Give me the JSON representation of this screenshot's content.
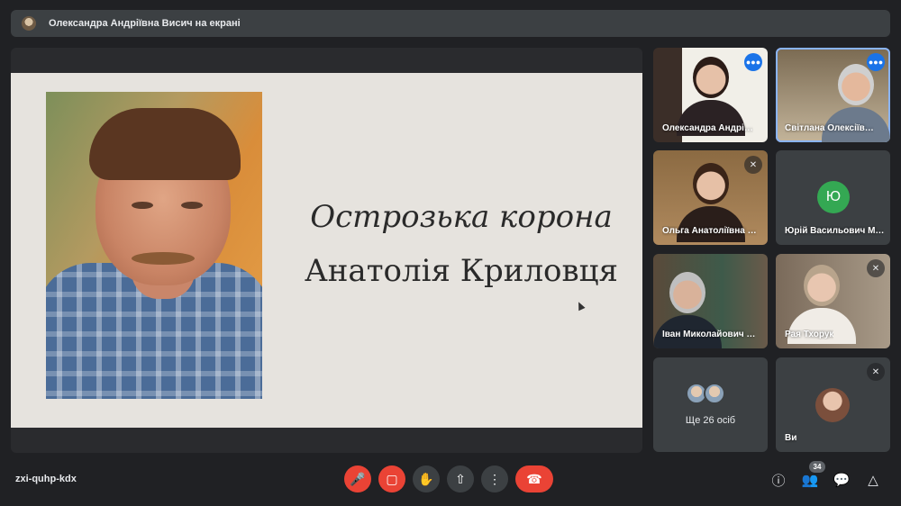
{
  "banner": {
    "presenting_text": "Олександра Андріївна Висич на екрані"
  },
  "slide": {
    "title_line1": "Острозька корона",
    "title_line2": "Анатолія Криловця"
  },
  "tiles": [
    {
      "name": "Олександра Андрі…",
      "status_icon": "speaking-icon"
    },
    {
      "name": "Світлана Олексіїв…",
      "status_icon": "speaking-icon",
      "active": true
    },
    {
      "name": "Ольга Анатоліївна …",
      "status_icon": "mic-off-icon"
    },
    {
      "name": "Юрій Васильович М…",
      "avatar_letter": "Ю",
      "avatar_color": "#34a853"
    },
    {
      "name": "Іван Миколайович …"
    },
    {
      "name": "Рая Тхорук",
      "status_icon": "mic-off-icon"
    },
    {
      "more_label": "Ще 26 осіб"
    },
    {
      "name": "Ви",
      "status_icon": "mic-off-icon"
    }
  ],
  "bottom": {
    "meeting_code": "zxi-quhp-kdx",
    "participant_count": "34",
    "controls": [
      "mic-off-icon",
      "camera-off-icon",
      "raise-hand-icon",
      "present-icon",
      "more-options-icon",
      "hang-up-icon"
    ],
    "right_icons": [
      "info-icon",
      "people-icon",
      "chat-icon",
      "activities-icon"
    ]
  },
  "colors": {
    "accent": "#1a73e8",
    "danger": "#ea4335",
    "bg": "#202124",
    "tile": "#3c4043"
  }
}
